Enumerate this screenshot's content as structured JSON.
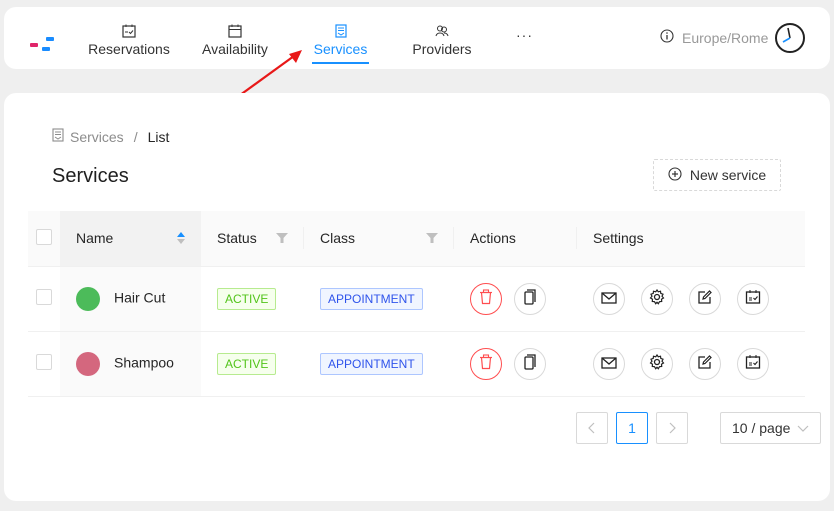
{
  "topbar": {
    "nav": [
      {
        "label": "Reservations",
        "icon": "calendar-check-icon"
      },
      {
        "label": "Availability",
        "icon": "calendar-icon"
      },
      {
        "label": "Services",
        "icon": "services-icon",
        "active": true
      },
      {
        "label": "Providers",
        "icon": "providers-icon"
      }
    ],
    "more_label": "···",
    "timezone": "Europe/Rome"
  },
  "breadcrumb": {
    "root": "Services",
    "separator": "/",
    "current": "List"
  },
  "page_title": "Services",
  "new_button_label": "New service",
  "table": {
    "columns": [
      "Name",
      "Status",
      "Class",
      "Actions",
      "Settings"
    ],
    "rows": [
      {
        "name": "Hair Cut",
        "color": "#4cbb5a",
        "status": "ACTIVE",
        "class": "APPOINTMENT"
      },
      {
        "name": "Shampoo",
        "color": "#d4677e",
        "status": "ACTIVE",
        "class": "APPOINTMENT"
      }
    ]
  },
  "pagination": {
    "prev": "<",
    "current_page": "1",
    "next": ">",
    "page_size": "10 / page"
  },
  "colors": {
    "accent": "#1890ff",
    "danger": "#ff4d4f"
  }
}
